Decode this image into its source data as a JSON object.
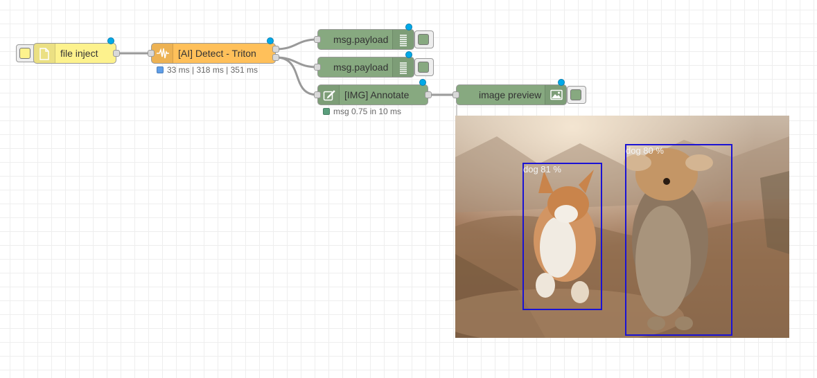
{
  "nodes": {
    "file_inject": {
      "label": "file inject",
      "color": "#fdf28d"
    },
    "detect": {
      "label": "[AI] Detect - Triton",
      "color": "#ffc05a",
      "status": "33 ms | 318 ms | 351 ms",
      "status_color": "#5f9ee8"
    },
    "debug1": {
      "label": "msg.payload",
      "color": "#87a980"
    },
    "debug2": {
      "label": "msg.payload",
      "color": "#87a980"
    },
    "annotate": {
      "label": "[IMG] Annotate",
      "color": "#87a980",
      "status": "msg 0.75 in 10 ms",
      "status_color": "#5a9e7c"
    },
    "image_preview": {
      "label": "image preview",
      "color": "#87a980"
    }
  },
  "icons": {
    "file_inject": "file-icon",
    "detect": "waveform-icon",
    "debug": "list-icon",
    "annotate": "edit-icon",
    "image_preview": "image-icon"
  },
  "wire_color": "#999999",
  "changed_indicator_color": "#00a9e8",
  "preview": {
    "detections": [
      {
        "label": "dog 81 %"
      },
      {
        "label": "dog 80 %"
      }
    ],
    "box_color": "#1a12d4"
  }
}
